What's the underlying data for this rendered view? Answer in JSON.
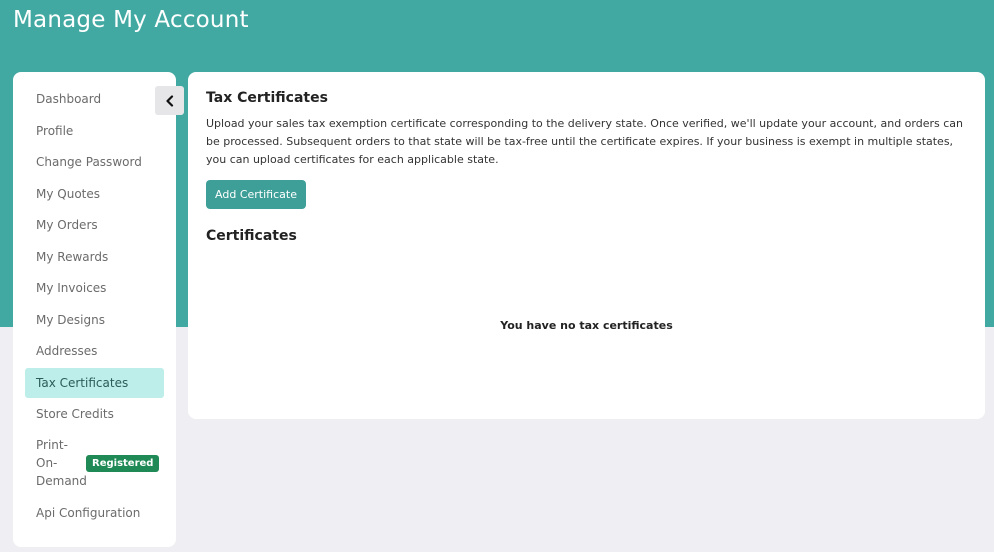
{
  "header": {
    "title": "Manage My Account"
  },
  "sidebar": {
    "items": [
      {
        "label": "Dashboard"
      },
      {
        "label": "Profile"
      },
      {
        "label": "Change Password"
      },
      {
        "label": "My Quotes"
      },
      {
        "label": "My Orders"
      },
      {
        "label": "My Rewards"
      },
      {
        "label": "My Invoices"
      },
      {
        "label": "My Designs"
      },
      {
        "label": "Addresses"
      },
      {
        "label": "Tax Certificates",
        "active": true
      },
      {
        "label": "Store Credits"
      }
    ],
    "pod": {
      "label": "Print-On-Demand",
      "badge": "Registered"
    },
    "api": {
      "label": "Api Configuration"
    },
    "collapse_icon": "chevron-left-icon"
  },
  "main": {
    "title": "Tax Certificates",
    "description": "Upload your sales tax exemption certificate corresponding to the delivery state. Once verified, we'll update your account, and orders can be processed. Subsequent orders to that state will be tax-free until the certificate expires. If your business is exempt in multiple states, you can upload certificates for each applicable state.",
    "add_button": "Add Certificate",
    "certificates_title": "Certificates",
    "empty_message": "You have no tax certificates"
  },
  "colors": {
    "header_bg": "#41a9a2",
    "active_item_bg": "#bdeeea",
    "button_bg": "#3e9f98",
    "badge_bg": "#1f8a55"
  }
}
